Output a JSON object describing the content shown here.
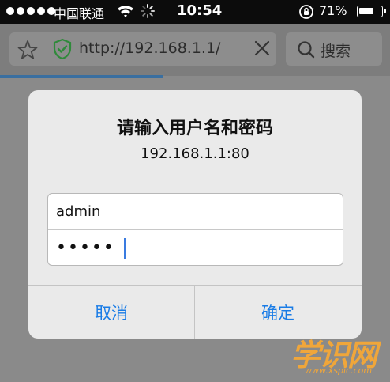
{
  "status_bar": {
    "carrier": "中国联通",
    "time": "10:54",
    "battery_percent": "71%",
    "battery_level": 0.71,
    "signal_bars": 5
  },
  "browser": {
    "url": "http://192.168.1.1/",
    "search_label": "搜索",
    "accent_color": "#3a6fa0",
    "load_progress": 0.42
  },
  "dialog": {
    "title": "请输入用户名和密码",
    "host": "192.168.1.1:80",
    "username_value": "admin",
    "password_value": "•••••",
    "cancel_label": "取消",
    "ok_label": "确定",
    "button_color": "#1a7ce6"
  },
  "watermark": {
    "text": "学识网",
    "site": "www.xspic.com"
  }
}
